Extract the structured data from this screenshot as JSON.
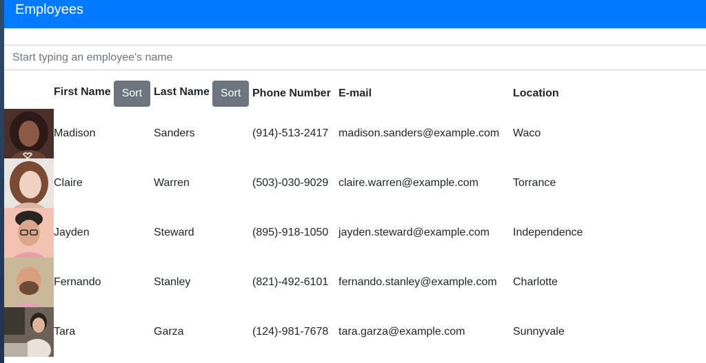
{
  "app": {
    "title": "Employees"
  },
  "search": {
    "placeholder": "Start typing an employee's name",
    "value": ""
  },
  "table": {
    "headers": {
      "first_name": "First Name",
      "last_name": "Last Name",
      "phone": "Phone Number",
      "email": "E-mail",
      "location": "Location"
    },
    "sort_label": "Sort",
    "rows": [
      {
        "first": "Madison",
        "last": "Sanders",
        "phone": "(914)-513-2417",
        "email": "madison.sanders@example.com",
        "location": "Waco"
      },
      {
        "first": "Claire",
        "last": "Warren",
        "phone": "(503)-030-9029",
        "email": "claire.warren@example.com",
        "location": "Torrance"
      },
      {
        "first": "Jayden",
        "last": "Steward",
        "phone": "(895)-918-1050",
        "email": "jayden.steward@example.com",
        "location": "Independence"
      },
      {
        "first": "Fernando",
        "last": "Stanley",
        "phone": "(821)-492-6101",
        "email": "fernando.stanley@example.com",
        "location": "Charlotte"
      },
      {
        "first": "Tara",
        "last": "Garza",
        "phone": "(124)-981-7678",
        "email": "tara.garza@example.com",
        "location": "Sunnyvale"
      }
    ]
  },
  "colors": {
    "navbar": "#007bff",
    "sort_button": "#6c757d"
  }
}
